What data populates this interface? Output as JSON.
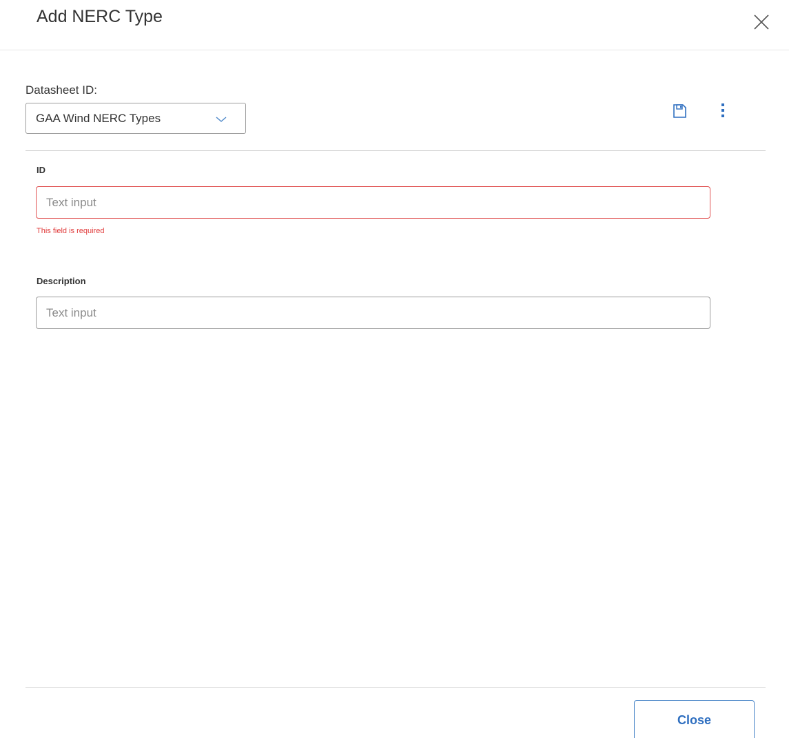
{
  "dialog": {
    "title": "Add NERC Type",
    "close_icon": "close-x-icon"
  },
  "datasheet": {
    "label": "Datasheet ID:",
    "selected": "GAA Wind NERC Types",
    "chevron_icon": "chevron-down-icon"
  },
  "toolbar": {
    "save_icon": "floppy-disk-icon",
    "more_icon": "vertical-ellipsis-icon",
    "icon_color": "#2f6fc0"
  },
  "fields": {
    "id": {
      "label": "ID",
      "value": "",
      "placeholder": "Text input",
      "error": "This field is required"
    },
    "description": {
      "label": "Description",
      "value": "",
      "placeholder": "Text input"
    }
  },
  "footer": {
    "close_label": "Close"
  },
  "colors": {
    "error": "#e03a3a",
    "accent": "#2f6fc0"
  }
}
